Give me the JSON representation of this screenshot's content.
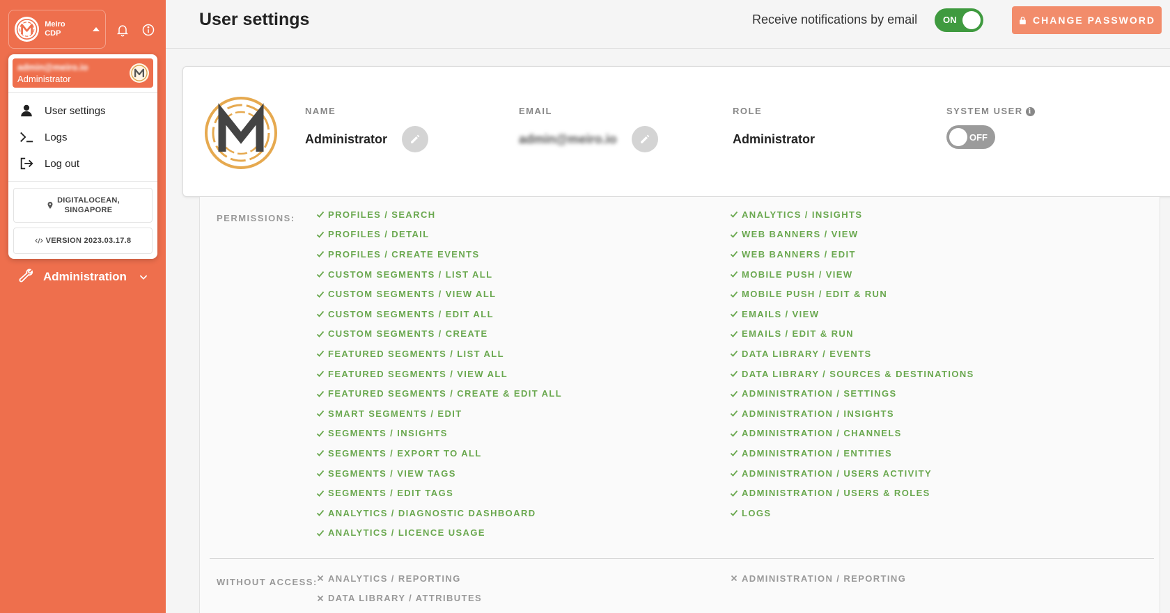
{
  "sidebar": {
    "brand_name": "Meiro CDP",
    "dropdown": {
      "user_email": "admin@meiro.io",
      "user_role": "Administrator",
      "menu": [
        {
          "label": "User settings",
          "icon": "user-icon"
        },
        {
          "label": "Logs",
          "icon": "terminal-icon"
        },
        {
          "label": "Log out",
          "icon": "logout-icon"
        }
      ],
      "location": "DIGITALOCEAN, SINGAPORE",
      "location_line1": "DIGITALOCEAN,",
      "location_line2": "SINGAPORE",
      "version": "VERSION 2023.03.17.8"
    },
    "admin_label": "Administration"
  },
  "header": {
    "title": "User settings",
    "notify_label": "Receive notifications by email",
    "notify_toggle": "ON",
    "change_password": "CHANGE PASSWORD"
  },
  "profile": {
    "name_label": "NAME",
    "name_value": "Administrator",
    "email_label": "EMAIL",
    "email_value": "admin@meiro.io",
    "role_label": "ROLE",
    "role_value": "Administrator",
    "system_user_label": "SYSTEM USER",
    "system_user_toggle": "OFF"
  },
  "permissions": {
    "title": "PERMISSIONS:",
    "left": [
      "PROFILES / SEARCH",
      "PROFILES / DETAIL",
      "PROFILES / CREATE EVENTS",
      "CUSTOM SEGMENTS / LIST ALL",
      "CUSTOM SEGMENTS / VIEW ALL",
      "CUSTOM SEGMENTS / EDIT ALL",
      "CUSTOM SEGMENTS / CREATE",
      "FEATURED SEGMENTS / LIST ALL",
      "FEATURED SEGMENTS / VIEW ALL",
      "FEATURED SEGMENTS / CREATE & EDIT ALL",
      "SMART SEGMENTS / EDIT",
      "SEGMENTS / INSIGHTS",
      "SEGMENTS / EXPORT TO ALL",
      "SEGMENTS / VIEW TAGS",
      "SEGMENTS / EDIT TAGS",
      "ANALYTICS / DIAGNOSTIC DASHBOARD",
      "ANALYTICS / LICENCE USAGE"
    ],
    "right": [
      "ANALYTICS / INSIGHTS",
      "WEB BANNERS / VIEW",
      "WEB BANNERS / EDIT",
      "MOBILE PUSH / VIEW",
      "MOBILE PUSH / EDIT & RUN",
      "EMAILS / VIEW",
      "EMAILS / EDIT & RUN",
      "DATA LIBRARY / EVENTS",
      "DATA LIBRARY / SOURCES & DESTINATIONS",
      "ADMINISTRATION / SETTINGS",
      "ADMINISTRATION / INSIGHTS",
      "ADMINISTRATION / CHANNELS",
      "ADMINISTRATION / ENTITIES",
      "ADMINISTRATION / USERS ACTIVITY",
      "ADMINISTRATION / USERS & ROLES",
      "LOGS"
    ]
  },
  "without_access": {
    "title": "WITHOUT ACCESS:",
    "left": [
      "ANALYTICS / REPORTING",
      "DATA LIBRARY / ATTRIBUTES"
    ],
    "right": [
      "ADMINISTRATION / REPORTING"
    ]
  },
  "colors": {
    "accent": "#ee6f4d",
    "granted": "#6aa84f",
    "toggle_on": "#3f9a3f"
  }
}
